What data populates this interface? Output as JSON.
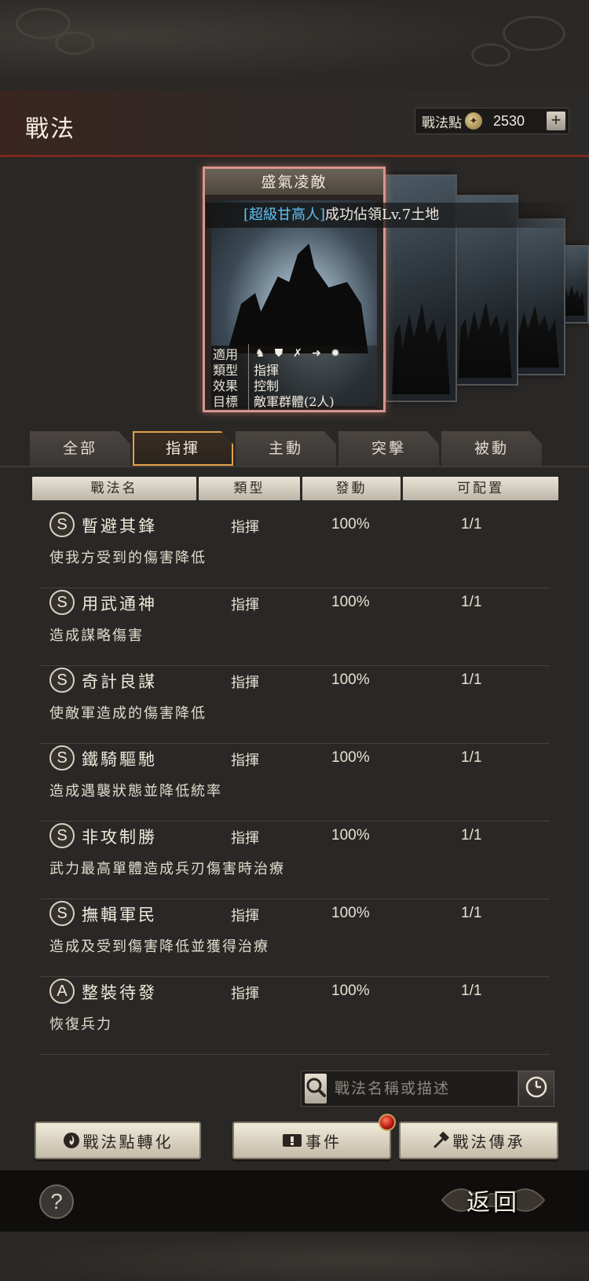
{
  "header": {
    "title": "戰法",
    "points_label": "戰法點",
    "points_value": "2530",
    "plus_label": "+"
  },
  "featured_card": {
    "name": "盛氣凌敵",
    "news_player": "[超級甘高人]",
    "news_text": "成功佔領Lv.7土地",
    "stats": [
      {
        "key": "適用",
        "value": ""
      },
      {
        "key": "類型",
        "value": "指揮"
      },
      {
        "key": "效果",
        "value": "控制"
      },
      {
        "key": "目標",
        "value": "敵軍群體(2人)"
      }
    ],
    "applicable_icons": [
      "cavalry-icon",
      "shield-icon",
      "archer-icon",
      "spear-icon",
      "wheel-icon"
    ]
  },
  "tabs": [
    {
      "label": "全部",
      "active": false
    },
    {
      "label": "指揮",
      "active": true
    },
    {
      "label": "主動",
      "active": false
    },
    {
      "label": "突擊",
      "active": false
    },
    {
      "label": "被動",
      "active": false
    }
  ],
  "table": {
    "headers": [
      "戰法名",
      "類型",
      "發動",
      "可配置"
    ],
    "rows": [
      {
        "grade": "S",
        "name": "暫避其鋒",
        "type": "指揮",
        "rate": "100%",
        "slots": "1/1",
        "desc": "使我方受到的傷害降低"
      },
      {
        "grade": "S",
        "name": "用武通神",
        "type": "指揮",
        "rate": "100%",
        "slots": "1/1",
        "desc": "造成謀略傷害"
      },
      {
        "grade": "S",
        "name": "奇計良謀",
        "type": "指揮",
        "rate": "100%",
        "slots": "1/1",
        "desc": "使敵軍造成的傷害降低"
      },
      {
        "grade": "S",
        "name": "鐵騎驅馳",
        "type": "指揮",
        "rate": "100%",
        "slots": "1/1",
        "desc": "造成遇襲狀態並降低統率"
      },
      {
        "grade": "S",
        "name": "非攻制勝",
        "type": "指揮",
        "rate": "100%",
        "slots": "1/1",
        "desc": "武力最高單體造成兵刃傷害時治療"
      },
      {
        "grade": "S",
        "name": "撫輯軍民",
        "type": "指揮",
        "rate": "100%",
        "slots": "1/1",
        "desc": "造成及受到傷害降低並獲得治療"
      },
      {
        "grade": "A",
        "name": "整裝待發",
        "type": "指揮",
        "rate": "100%",
        "slots": "1/1",
        "desc": "恢復兵力"
      }
    ]
  },
  "search": {
    "placeholder": "戰法名稱或描述"
  },
  "buttons": {
    "convert": "戰法點轉化",
    "events": "事件",
    "inherit": "戰法傳承"
  },
  "footer": {
    "help": "?",
    "back": "返回"
  }
}
